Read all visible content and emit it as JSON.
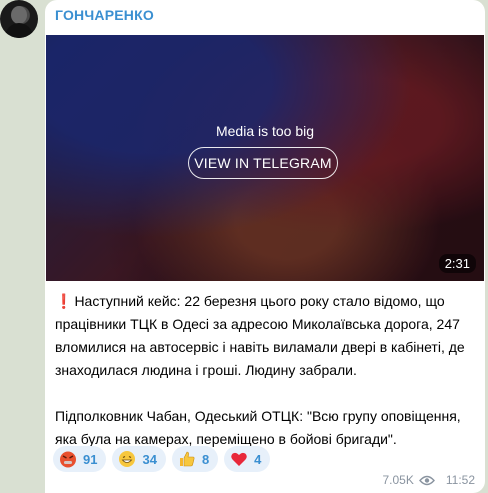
{
  "post": {
    "author": "ГОНЧАРЕНКО",
    "media": {
      "message": "Media is too big",
      "button_label": "VIEW IN TELEGRAM",
      "duration": "2:31"
    },
    "text": {
      "line1_prefix": "❗",
      "paragraph1": "Наступний кейс: 22 березня цього року стало відомо, що працівники ТЦК в Одесі за адресою Миколаївська дорога, 247 вломилися на автосервіс і навіть виламали двері в кабінеті, де знаходилася людина і гроші. Людину забрали.",
      "paragraph2": "Підполковник Чабан, Одеський ОТЦК: \"Всю групу оповіщення, яка була на камерах, переміщено в бойові бригади\"."
    },
    "reactions": [
      {
        "icon": "angry-face-icon",
        "count": "91"
      },
      {
        "icon": "grin-face-icon",
        "count": "34"
      },
      {
        "icon": "thumbs-up-icon",
        "count": "8"
      },
      {
        "icon": "heart-icon",
        "count": "4"
      }
    ],
    "views": "7.05K",
    "time": "11:52"
  }
}
